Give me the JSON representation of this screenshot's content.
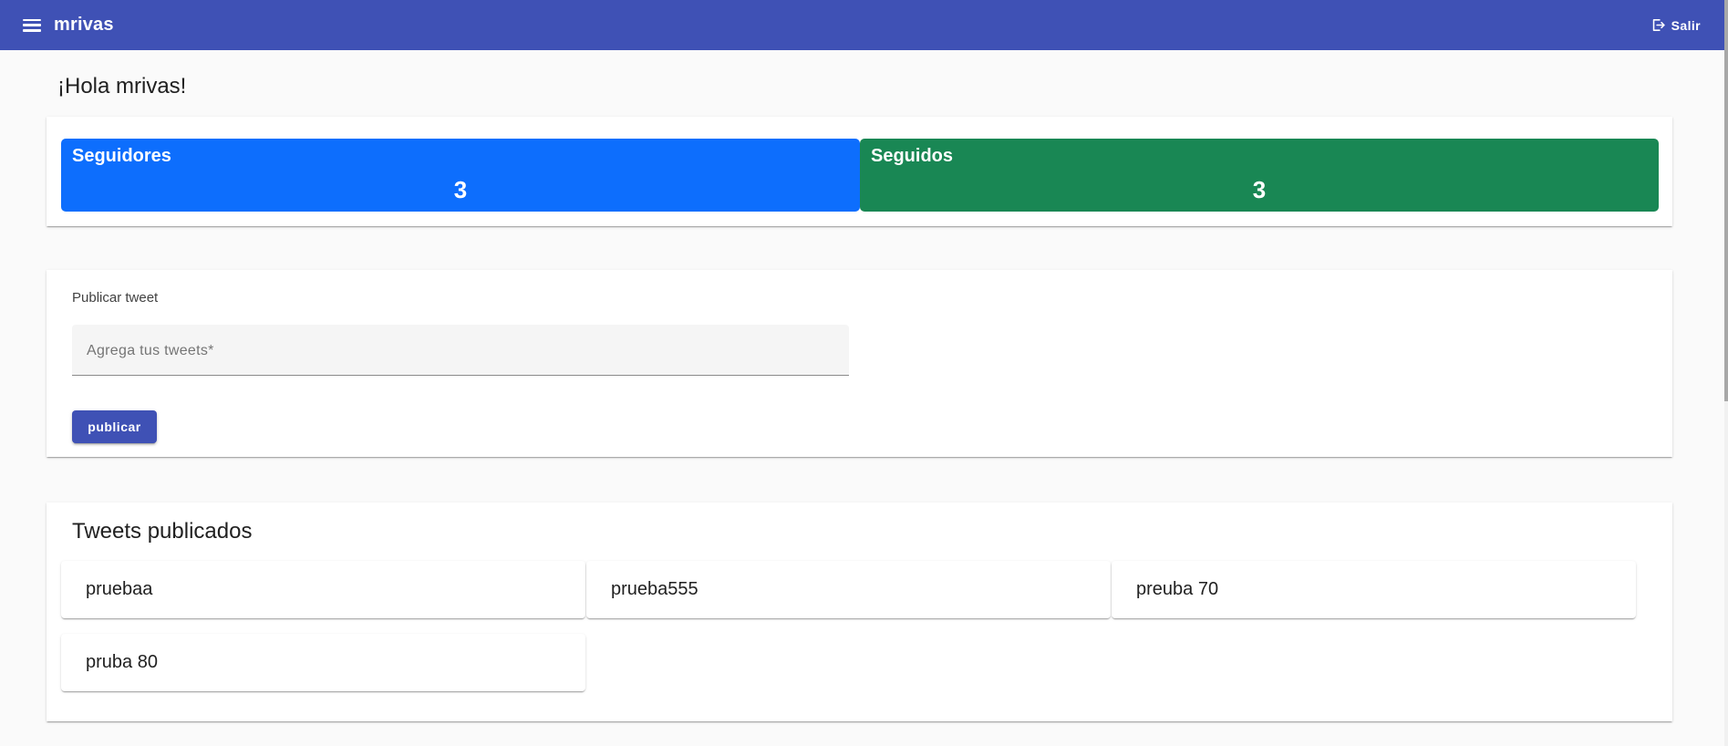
{
  "toolbar": {
    "menu_icon": "menu-icon",
    "title": "mrivas",
    "logout_icon": "logout-icon",
    "logout_label": "Salir",
    "color": "#3f51b5"
  },
  "greeting": "¡Hola mrivas!",
  "stats": {
    "followers": {
      "label": "Seguidores",
      "value": "3",
      "color": "#0d6efd"
    },
    "following": {
      "label": "Seguidos",
      "value": "3",
      "color": "#198754"
    }
  },
  "publish": {
    "title": "Publicar tweet",
    "input_placeholder": "Agrega tus tweets*",
    "input_value": "",
    "button_label": "publicar"
  },
  "tweets": {
    "title": "Tweets publicados",
    "items": [
      "pruebaa",
      "prueba555",
      "preuba 70",
      "pruba 80"
    ]
  }
}
